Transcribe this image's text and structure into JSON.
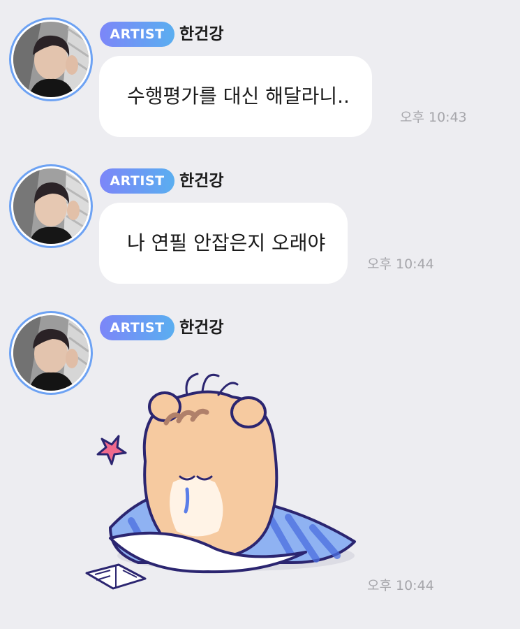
{
  "messages": [
    {
      "badge": "ARTIST",
      "sender": "한건강",
      "text": "수행평가를 대신 해달라니..",
      "time": "오후 10:43"
    },
    {
      "badge": "ARTIST",
      "sender": "한건강",
      "text": "나 연필 안잡은지 오래야",
      "time": "오후 10:44"
    },
    {
      "badge": "ARTIST",
      "sender": "한건강",
      "sticker": "sleepy-hamster-with-blanket-sticker",
      "time": "오후 10:44"
    }
  ],
  "colors": {
    "background": "#ededf1",
    "bubble": "#ffffff",
    "badge_gradient_start": "#7c86f8",
    "badge_gradient_end": "#5aaef0",
    "avatar_ring": "#6da2f3",
    "timestamp": "#a6a6ab"
  }
}
